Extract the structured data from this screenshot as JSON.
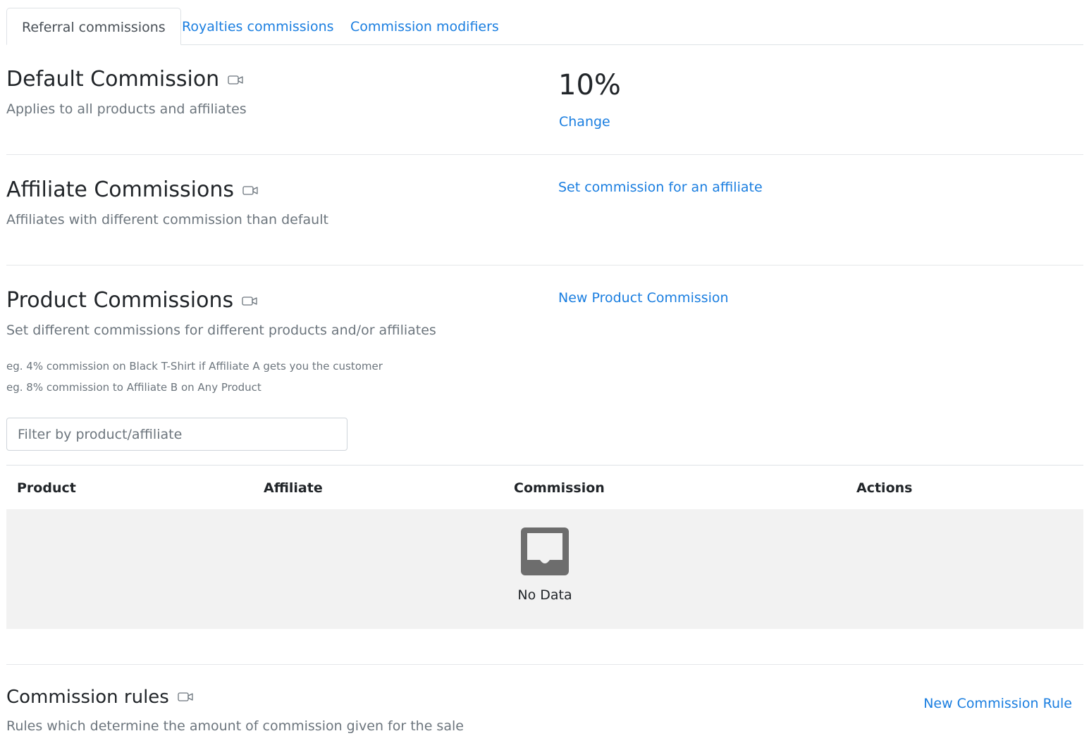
{
  "tabs": [
    {
      "label": "Referral commissions",
      "active": true
    },
    {
      "label": "Royalties commissions",
      "active": false
    },
    {
      "label": "Commission modifiers",
      "active": false
    }
  ],
  "default_commission": {
    "title": "Default Commission",
    "subtitle": "Applies to all products and affiliates",
    "value": "10%",
    "change_label": "Change"
  },
  "affiliate_commissions": {
    "title": "Affiliate Commissions",
    "subtitle": "Affiliates with different commission than default",
    "action_label": "Set commission for an affiliate"
  },
  "product_commissions": {
    "title": "Product Commissions",
    "subtitle": "Set different commissions for different products and/or affiliates",
    "examples": [
      "eg. 4% commission on Black T-Shirt if Affiliate A gets you the customer",
      "eg. 8% commission to Affiliate B on Any Product"
    ],
    "action_label": "New Product Commission",
    "filter_placeholder": "Filter by product/affiliate",
    "table": {
      "columns": [
        "Product",
        "Affiliate",
        "Commission",
        "Actions"
      ],
      "rows": [],
      "empty_text": "No Data"
    }
  },
  "commission_rules": {
    "title": "Commission rules",
    "subtitle": "Rules which determine the amount of commission given for the sale",
    "action_label": "New Commission Rule"
  },
  "icons": {
    "section_video": "video-camera-icon",
    "empty_table": "inbox-icon"
  },
  "colors": {
    "link": "#1a7ee0",
    "muted_text": "#6c757d",
    "empty_bg": "#f2f2f2",
    "empty_icon": "#6d6d6d"
  }
}
